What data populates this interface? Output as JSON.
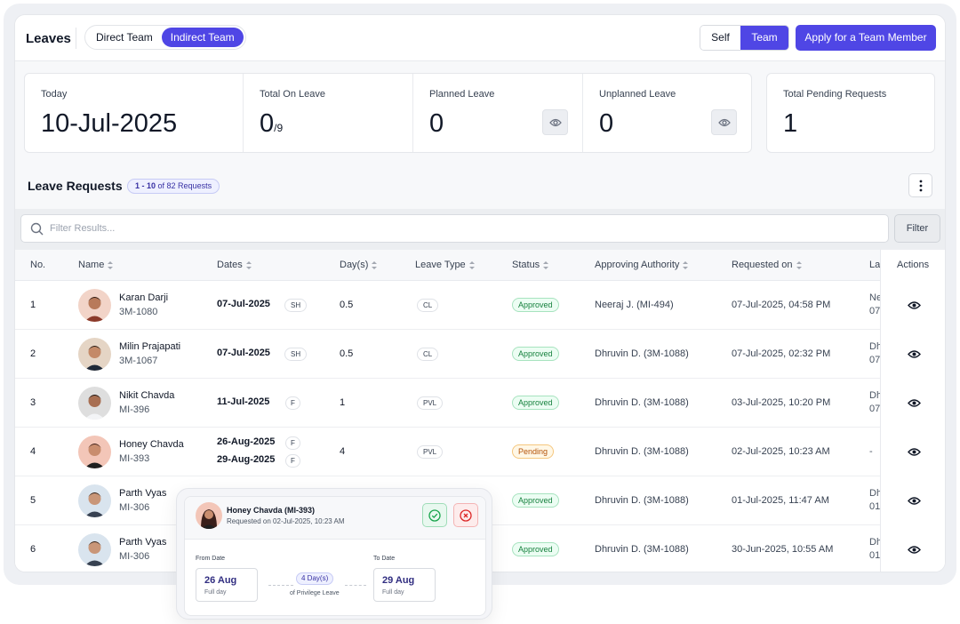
{
  "header": {
    "title": "Leaves",
    "segments": [
      "Direct Team",
      "Indirect Team"
    ],
    "toggle": [
      "Self",
      "Team"
    ],
    "apply_label": "Apply for a Team Member"
  },
  "stats": {
    "today_label": "Today",
    "today_value": "10-Jul-2025",
    "total_on_leave_label": "Total On Leave",
    "total_on_leave_value": "0",
    "total_on_leave_total": "/9",
    "planned_label": "Planned Leave",
    "planned_value": "0",
    "unplanned_label": "Unplanned Leave",
    "unplanned_value": "0",
    "pending_label": "Total Pending Requests",
    "pending_value": "1"
  },
  "requests": {
    "title": "Leave Requests",
    "badge_range": "1 - 10",
    "badge_rest": "of 82 Requests",
    "filter_placeholder": "Filter Results...",
    "filter_label": "Filter"
  },
  "table": {
    "columns": [
      "No.",
      "Name",
      "Dates",
      "Day(s)",
      "Leave Type",
      "Status",
      "Approving Authority",
      "Requested on",
      "La",
      "Actions"
    ],
    "rows": [
      {
        "no": "1",
        "name": "Karan Darji",
        "code": "3M-1080",
        "dates": [
          "07-Jul-2025"
        ],
        "tags": [
          "SH"
        ],
        "days": "0.5",
        "type": "CL",
        "status": "Approved",
        "authority": "Neeraj J. (MI-494)",
        "requested": "07-Jul-2025, 04:58 PM",
        "last": [
          "Ne",
          "07"
        ]
      },
      {
        "no": "2",
        "name": "Milin Prajapati",
        "code": "3M-1067",
        "dates": [
          "07-Jul-2025"
        ],
        "tags": [
          "SH"
        ],
        "days": "0.5",
        "type": "CL",
        "status": "Approved",
        "authority": "Dhruvin D. (3M-1088)",
        "requested": "07-Jul-2025, 02:32 PM",
        "last": [
          "Dh",
          "07"
        ]
      },
      {
        "no": "3",
        "name": "Nikit Chavda",
        "code": "MI-396",
        "dates": [
          "11-Jul-2025"
        ],
        "tags": [
          "F"
        ],
        "days": "1",
        "type": "PVL",
        "status": "Approved",
        "authority": "Dhruvin D. (3M-1088)",
        "requested": "03-Jul-2025, 10:20 PM",
        "last": [
          "Dh",
          "07"
        ]
      },
      {
        "no": "4",
        "name": "Honey Chavda",
        "code": "MI-393",
        "dates": [
          "26-Aug-2025",
          "29-Aug-2025"
        ],
        "tags": [
          "F",
          "F"
        ],
        "days": "4",
        "type": "PVL",
        "status": "Pending",
        "authority": "Dhruvin D. (3M-1088)",
        "requested": "02-Jul-2025, 10:23 AM",
        "last": [
          "-"
        ]
      },
      {
        "no": "5",
        "name": "Parth Vyas",
        "code": "MI-306",
        "dates": [],
        "tags": [],
        "days": "",
        "type": "",
        "status": "Approved",
        "authority": "Dhruvin D. (3M-1088)",
        "requested": "01-Jul-2025, 11:47 AM",
        "last": [
          "Dh",
          "01"
        ]
      },
      {
        "no": "6",
        "name": "Parth Vyas",
        "code": "MI-306",
        "dates": [],
        "tags": [],
        "days": "",
        "type": "",
        "status": "Approved",
        "authority": "Dhruvin D. (3M-1088)",
        "requested": "30-Jun-2025, 10:55 AM",
        "last": [
          "Dh",
          "01"
        ]
      }
    ]
  },
  "popup": {
    "name": "Honey Chavda (MI-393)",
    "requested": "Requested on 02-Jul-2025, 10:23 AM",
    "from_label": "From Date",
    "from_date": "26 Aug",
    "from_type": "Full day",
    "to_label": "To Date",
    "to_date": "29 Aug",
    "to_type": "Full day",
    "days": "4 Day(s)",
    "leave_kind": "of Privilege Leave"
  },
  "colors": {
    "accent": "#4f46e5",
    "approved": "#15803d",
    "pending": "#b45309"
  },
  "icons": [
    "search-icon",
    "eye-icon",
    "kebab-icon",
    "check-icon",
    "close-icon",
    "avatar"
  ]
}
